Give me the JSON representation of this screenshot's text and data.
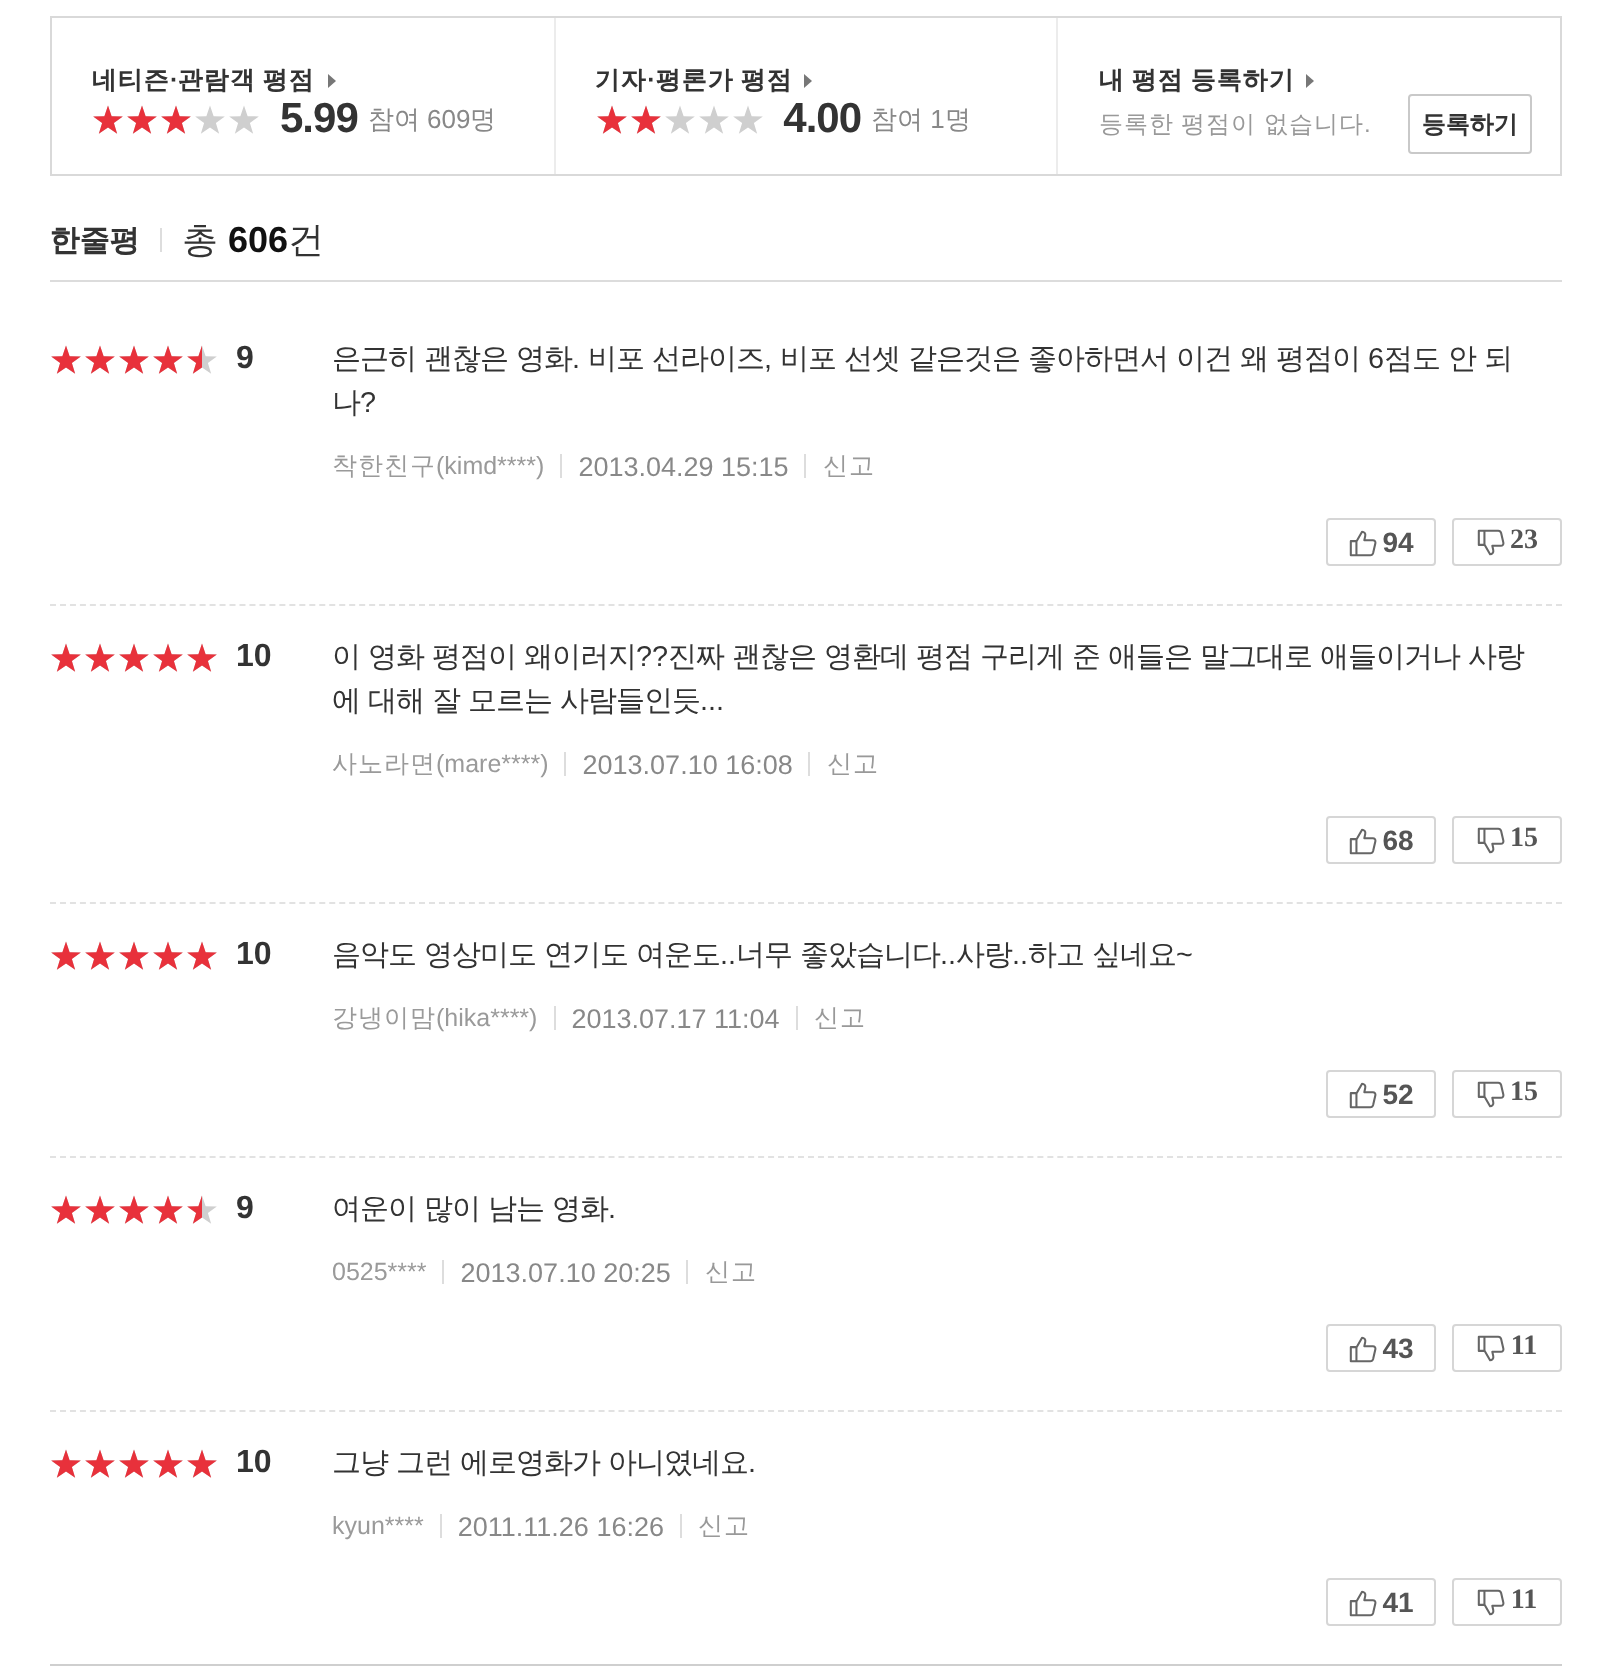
{
  "panels": [
    {
      "kind": "rating",
      "title": "네티즌·관람객 평점",
      "stars": 3,
      "score": "5.99",
      "participants": "참여 609명"
    },
    {
      "kind": "rating",
      "title": "기자·평론가 평점",
      "stars": 2,
      "score": "4.00",
      "participants": "참여 1명"
    },
    {
      "kind": "my_rating",
      "title": "내 평점 등록하기",
      "message": "등록한 평점이 없습니다.",
      "button": "등록하기"
    }
  ],
  "reviews_header": {
    "title": "한줄평",
    "total": "총 **606**건"
  },
  "reviews": [
    {
      "stars": 4.5,
      "score": "9",
      "text": "은근히 괜찮은 영화. 비포 선라이즈, 비포 선셋 같은것은 좋아하면서 이건 왜 평점이 6점도 안 되나?",
      "user": "착한친구(kimd****)",
      "date": "2013.04.29 15:15",
      "report": "신고",
      "likes": "94",
      "dislikes": "23"
    },
    {
      "stars": 5,
      "score": "10",
      "text": "이 영화 평점이 왜이러지??진짜 괜찮은 영환데 평점 구리게 준 애들은 말그대로 애들이거나 사랑에 대해 잘 모르는 사람들인듯...",
      "user": "사노라면(mare****)",
      "date": "2013.07.10 16:08",
      "report": "신고",
      "likes": "68",
      "dislikes": "15"
    },
    {
      "stars": 5,
      "score": "10",
      "text": "음악도 영상미도 연기도 여운도..너무 좋았습니다..사랑..하고 싶네요~",
      "user": "강냉이맘(hika****)",
      "date": "2013.07.17 11:04",
      "report": "신고",
      "likes": "52",
      "dislikes": "15"
    },
    {
      "stars": 4.5,
      "score": "9",
      "text": "여운이 많이 남는 영화.",
      "user": "0525****",
      "date": "2013.07.10 20:25",
      "report": "신고",
      "likes": "43",
      "dislikes": "11"
    },
    {
      "stars": 5,
      "score": "10",
      "text": "그냥 그런 에로영화가 아니였네요.",
      "user": "kyun****",
      "date": "2011.11.26 16:26",
      "report": "신고",
      "likes": "41",
      "dislikes": "11"
    }
  ]
}
